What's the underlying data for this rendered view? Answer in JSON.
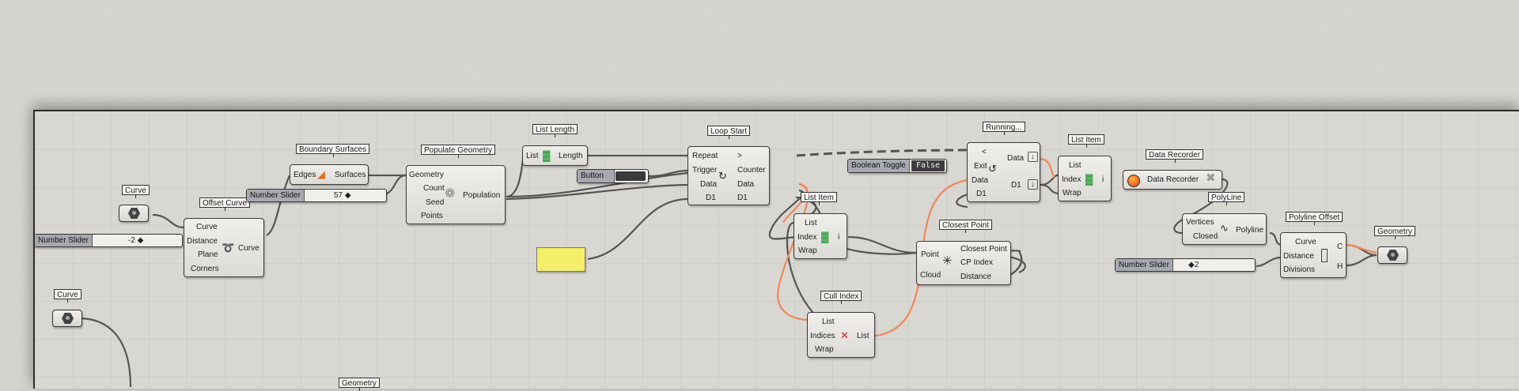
{
  "components": {
    "curve1": {
      "label": "Curve"
    },
    "curve2": {
      "label": "Curve"
    },
    "geometry_bottom": {
      "label": "Geometry"
    },
    "slider_distance": {
      "name": "Number Slider",
      "value": "-2 ◆"
    },
    "offset_curve": {
      "label": "Offset Curve",
      "inputs": [
        "Curve",
        "Distance",
        "Plane",
        "Corners"
      ],
      "output": "Curve"
    },
    "boundary_surfaces": {
      "label": "Boundary Surfaces",
      "input": "Edges",
      "output": "Surfaces"
    },
    "slider_count": {
      "name": "Number Slider",
      "value": "57 ◆"
    },
    "populate_geometry": {
      "label": "Populate Geometry",
      "inputs": [
        "Geometry",
        "Count",
        "Seed",
        "Points"
      ],
      "output": "Population"
    },
    "list_length": {
      "label": "List Length",
      "input": "List",
      "output": "Length"
    },
    "button": {
      "label": "Button"
    },
    "loop_start": {
      "label": "Loop Start",
      "inputs": [
        "Repeat",
        "Trigger",
        "Data",
        "D1"
      ],
      "outputs": [
        ">",
        "Counter",
        "Data",
        "D1"
      ]
    },
    "boolean_toggle": {
      "label": "Boolean Toggle",
      "value": "False"
    },
    "running": {
      "label": "Running...",
      "inputs": [
        "<",
        "Exit",
        "Data",
        "D1"
      ],
      "outputs": [
        "Data",
        "D1"
      ]
    },
    "list_item_1": {
      "label": "List Item",
      "inputs": [
        "List",
        "Index",
        "Wrap"
      ],
      "output": "i"
    },
    "list_item_2": {
      "label": "List Item",
      "inputs": [
        "List",
        "Index",
        "Wrap"
      ],
      "output": "i"
    },
    "cull_index": {
      "label": "Cull Index",
      "inputs": [
        "List",
        "Indices",
        "Wrap"
      ],
      "output": "List"
    },
    "closest_point": {
      "label": "Closest Point",
      "inputs": [
        "Point",
        "Cloud"
      ],
      "outputs": [
        "Closest Point",
        "CP Index",
        "Distance"
      ]
    },
    "data_recorder": {
      "label": "Data Recorder",
      "name": "Data Recorder"
    },
    "polyline": {
      "label": "PolyLine",
      "inputs": [
        "Vertices",
        "Closed"
      ],
      "output": "Polyline"
    },
    "polyline_offset": {
      "label": "Polyline Offset",
      "inputs": [
        "Curve",
        "Distance",
        "Divisions"
      ],
      "outputs": [
        "C",
        "H"
      ]
    },
    "slider_offset": {
      "name": "Number Slider",
      "value": "◆2"
    },
    "geometry_out": {
      "label": "Geometry"
    }
  },
  "colors": {
    "wire": "#5a5a5a",
    "selected_wire": "#f0875a",
    "panel": "#f5ee6a",
    "toggle_bg": "#3c3c3c"
  },
  "icons": [
    "hexagon-param-icon",
    "offset-curve-icon",
    "boundary-surface-icon",
    "populate-geometry-icon",
    "list-length-icon",
    "loop-start-icon",
    "loop-end-icon",
    "list-item-icon",
    "cull-index-icon",
    "closest-point-icon",
    "data-recorder-icon",
    "polyline-icon",
    "polyline-offset-icon",
    "clear-x-icon"
  ]
}
